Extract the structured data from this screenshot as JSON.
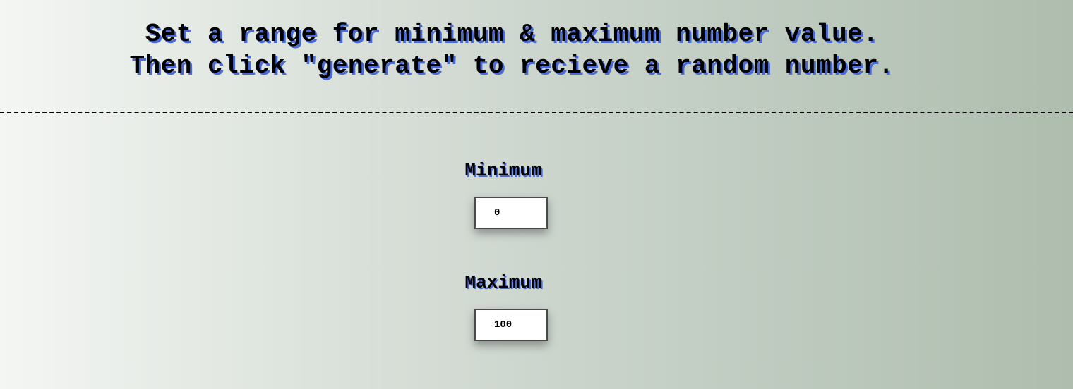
{
  "header": {
    "line1": "Set a range for minimum & maximum number value.",
    "line2": "Then click \"generate\" to recieve a random number."
  },
  "form": {
    "minimum": {
      "label": "Minimum",
      "value": "0"
    },
    "maximum": {
      "label": "Maximum",
      "value": "100"
    }
  },
  "colors": {
    "text_shadow": "#4a6ad6",
    "background_start": "#f4f6f3",
    "background_end": "#aebdae"
  }
}
